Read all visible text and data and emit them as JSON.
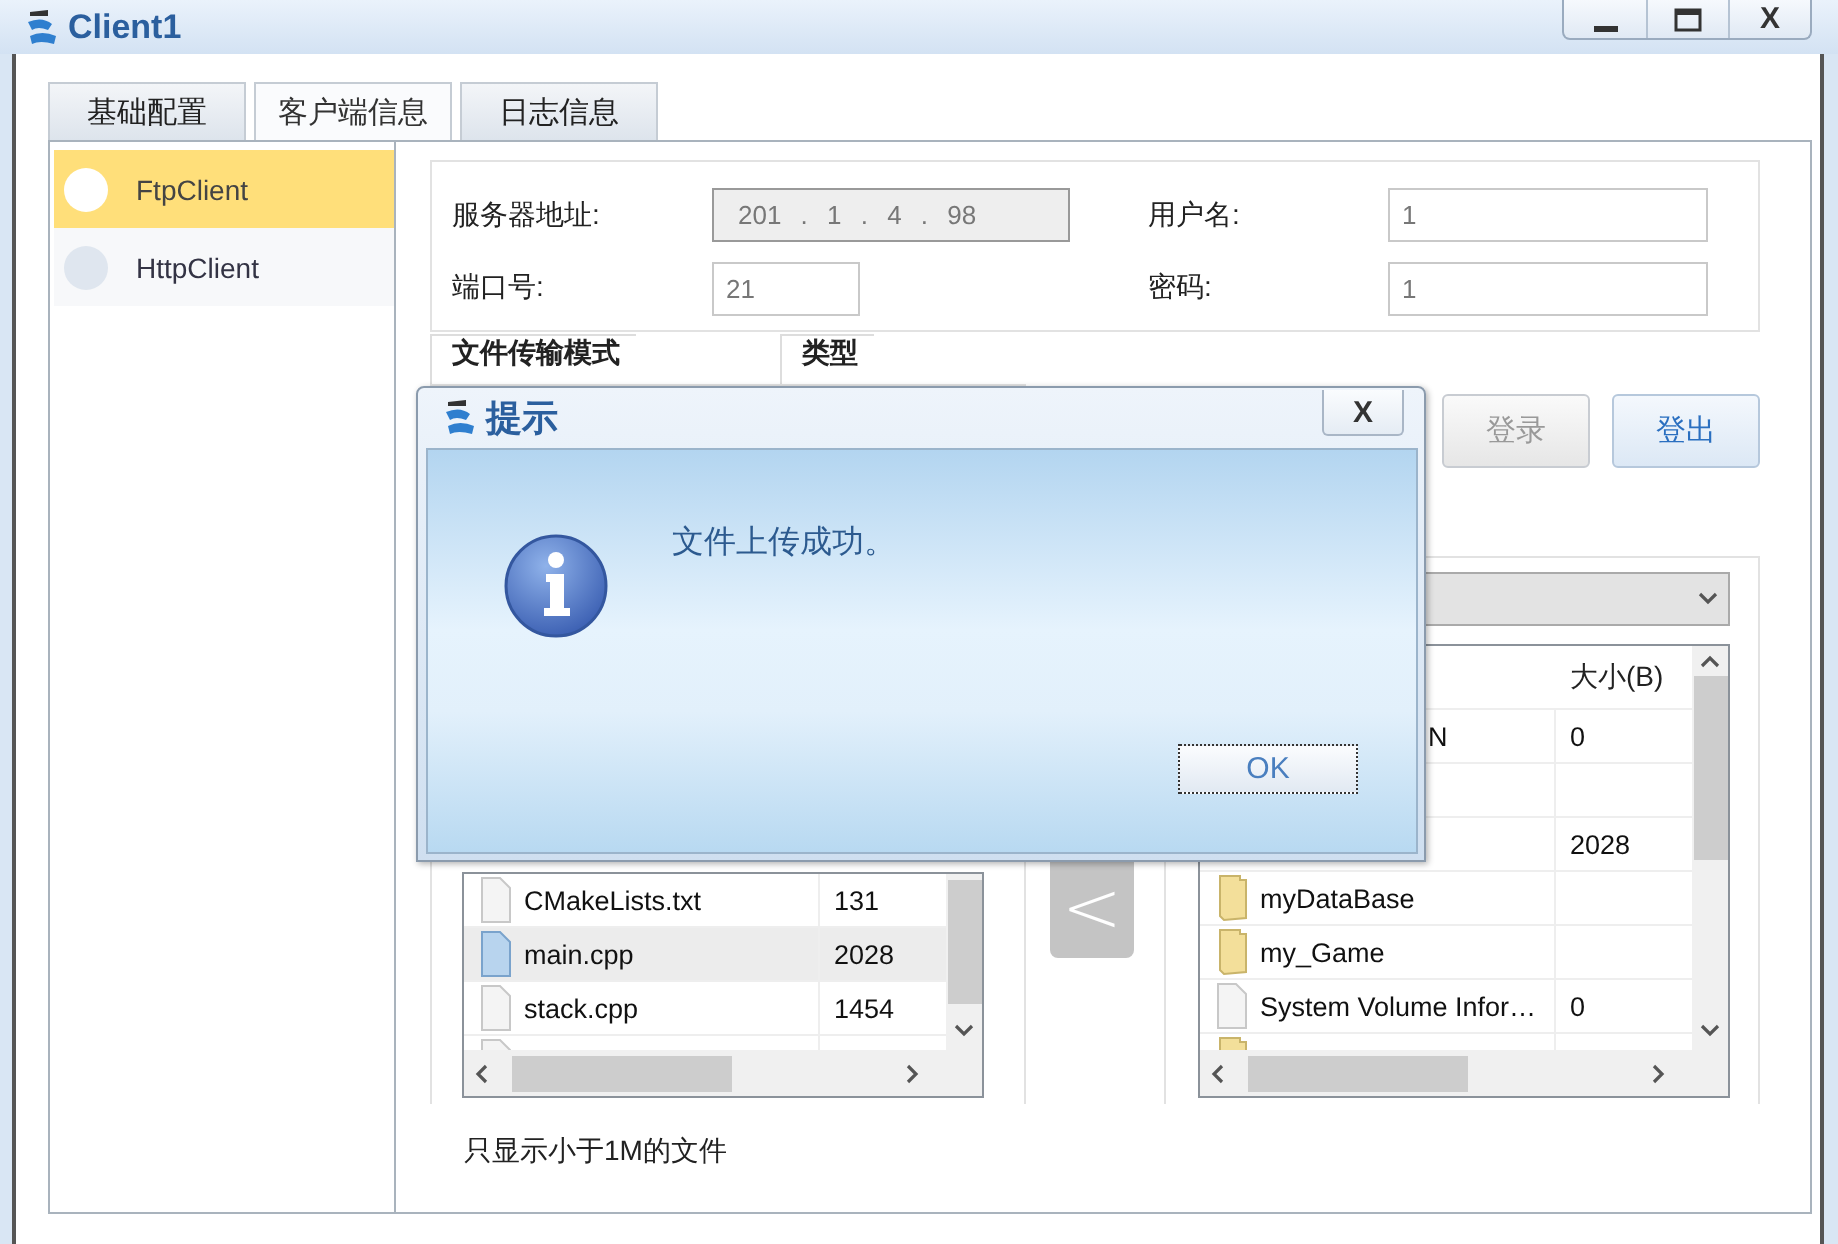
{
  "window": {
    "title": "Client1",
    "close_label": "X"
  },
  "tabs": [
    {
      "label": "基础配置",
      "selected": false
    },
    {
      "label": "客户端信息",
      "selected": true
    },
    {
      "label": "日志信息",
      "selected": false
    }
  ],
  "sidebar": {
    "items": [
      {
        "label": "FtpClient",
        "selected": true
      },
      {
        "label": "HttpClient",
        "selected": false
      }
    ]
  },
  "server_config": {
    "fields": [
      {
        "label": "服务器地址:",
        "kind": "ip",
        "value": "201 . 1 . 4 . 98"
      },
      {
        "label": "用户名:",
        "kind": "text",
        "value": "1"
      },
      {
        "label": "端口号:",
        "kind": "text",
        "value": "21"
      },
      {
        "label": "密码:",
        "kind": "text",
        "value": "1"
      }
    ]
  },
  "section_tabs": [
    "文件传输模式",
    "类型"
  ],
  "buttons": [
    {
      "label": "登录",
      "disabled": true
    },
    {
      "label": "登出",
      "disabled": false
    }
  ],
  "local_files": {
    "rows": [
      {
        "kind": "file",
        "name": "CMakeLists.txt",
        "size": "131",
        "selected": false
      },
      {
        "kind": "file",
        "name": "main.cpp",
        "size": "2028",
        "selected": true
      },
      {
        "kind": "file",
        "name": "stack.cpp",
        "size": "1454",
        "selected": false
      },
      {
        "kind": "file",
        "selected": false
      }
    ]
  },
  "transfer_button": {
    "label": "<"
  },
  "remote_files": {
    "columns": [
      "大小(B)"
    ],
    "rows": [
      {
        "name_tail": "N",
        "size": "0"
      },
      {},
      {
        "size": "2028"
      },
      {
        "kind": "folder",
        "name": "myDataBase"
      },
      {
        "kind": "folder",
        "name": "my_Game"
      },
      {
        "kind": "file",
        "name": "System Volume Infor…",
        "size": "0"
      },
      {
        "kind": "folder"
      }
    ]
  },
  "filter_note": "只显示小于1M的文件",
  "dialog": {
    "title": "提示",
    "message": "文件上传成功。",
    "button": "OK",
    "close_label": "X"
  }
}
